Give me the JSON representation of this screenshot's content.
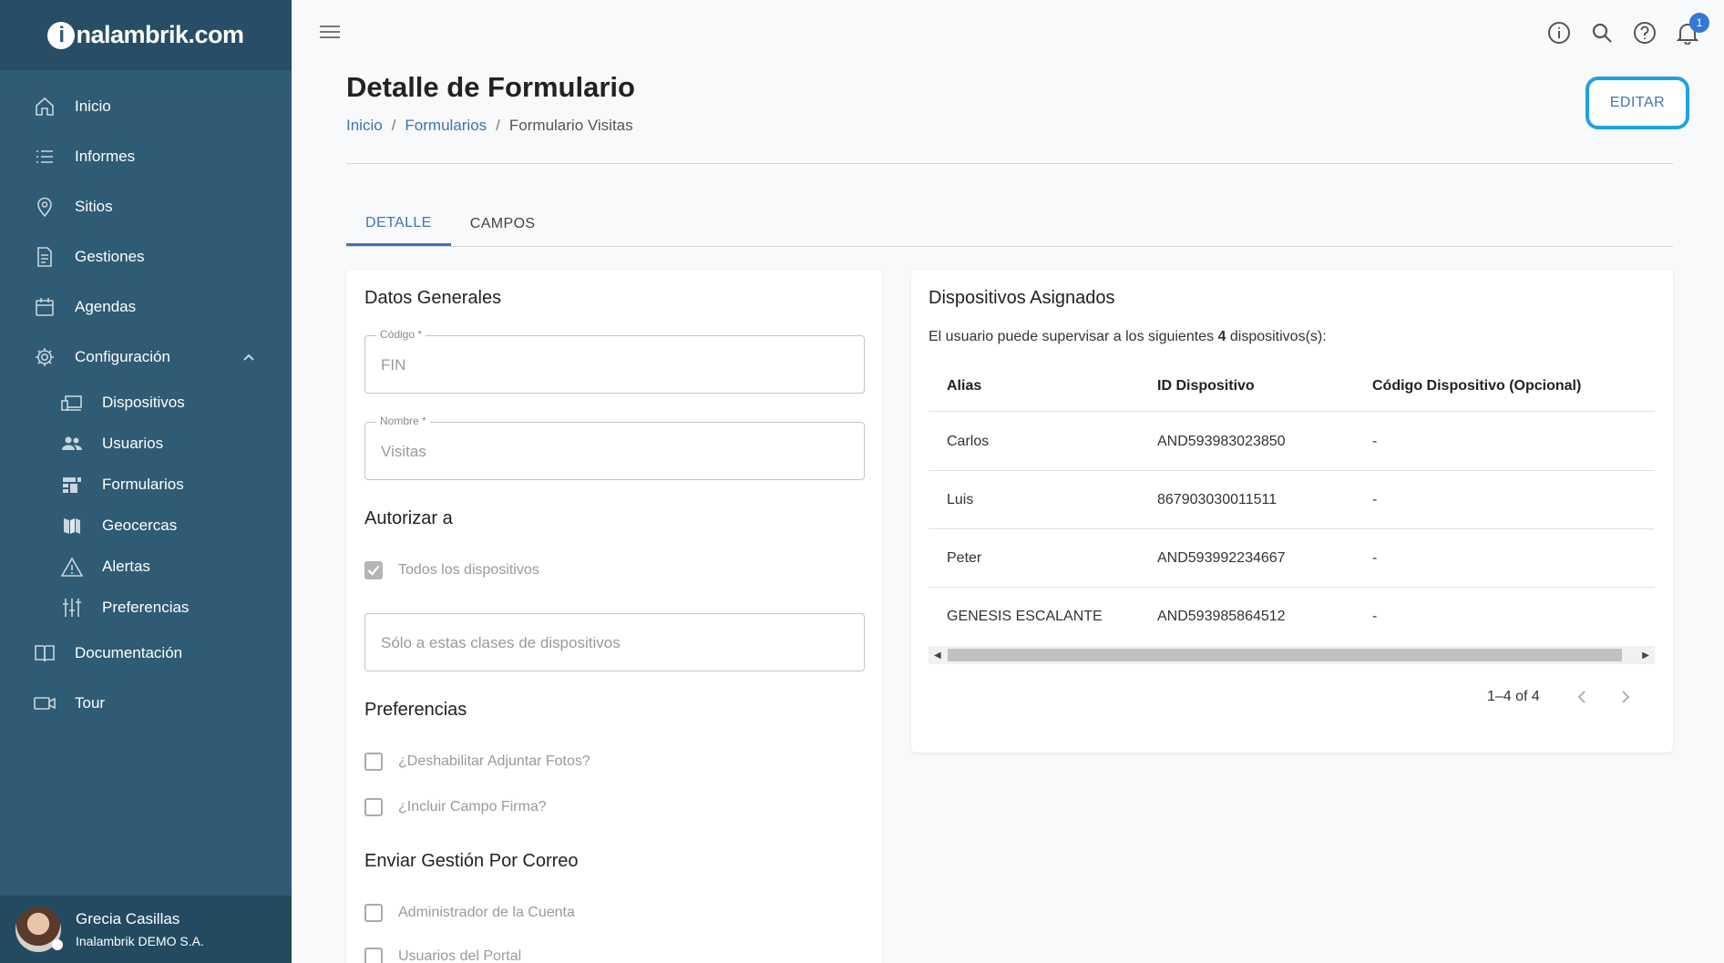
{
  "app": {
    "logo_text": "nalambrik.com",
    "logo_initial": "i"
  },
  "sidebar": {
    "items": [
      {
        "label": "Inicio",
        "icon": "home-icon"
      },
      {
        "label": "Informes",
        "icon": "list-icon"
      },
      {
        "label": "Sitios",
        "icon": "location-pin-icon"
      },
      {
        "label": "Gestiones",
        "icon": "document-icon"
      },
      {
        "label": "Agendas",
        "icon": "calendar-icon"
      },
      {
        "label": "Configuración",
        "icon": "gear-icon"
      }
    ],
    "subitems": [
      {
        "label": "Dispositivos",
        "icon": "devices-icon"
      },
      {
        "label": "Usuarios",
        "icon": "users-icon"
      },
      {
        "label": "Formularios",
        "icon": "forms-icon"
      },
      {
        "label": "Geocercas",
        "icon": "map-icon"
      },
      {
        "label": "Alertas",
        "icon": "warning-icon"
      },
      {
        "label": "Preferencias",
        "icon": "sliders-icon"
      }
    ],
    "bottom_items": [
      {
        "label": "Documentación",
        "icon": "book-icon"
      },
      {
        "label": "Tour",
        "icon": "video-icon"
      }
    ],
    "user": {
      "name": "Grecia Casillas",
      "org": "Inalambrik DEMO S.A."
    }
  },
  "topbar": {
    "notification_count": "1"
  },
  "header": {
    "title": "Detalle de Formulario",
    "breadcrumb": [
      "Inicio",
      "Formularios",
      "Formulario Visitas"
    ],
    "separator": "/",
    "edit_label": "EDITAR"
  },
  "tabs": [
    {
      "label": "DETALLE",
      "active": true
    },
    {
      "label": "CAMPOS",
      "active": false
    }
  ],
  "general": {
    "title": "Datos Generales",
    "code_label": "Código *",
    "code_value": "FIN",
    "name_label": "Nombre *",
    "name_value": "Visitas"
  },
  "authorize": {
    "title": "Autorizar a",
    "all_devices_label": "Todos los dispositivos",
    "all_devices_checked": true,
    "classes_placeholder": "Sólo a estas clases de dispositivos"
  },
  "preferences": {
    "title": "Preferencias",
    "options": [
      "¿Deshabilitar Adjuntar Fotos?",
      "¿Incluir Campo Firma?"
    ]
  },
  "email": {
    "title": "Enviar Gestión Por Correo",
    "options": [
      "Administrador de la Cuenta",
      "Usuarios del Portal"
    ]
  },
  "devices": {
    "title": "Dispositivos Asignados",
    "desc_pre": "El usuario puede supervisar a los siguientes ",
    "desc_count": "4",
    "desc_post": " dispositivos(s):",
    "columns": [
      "Alias",
      "ID Dispositivo",
      "Código Dispositivo (Opcional)"
    ],
    "rows": [
      [
        "Carlos",
        "AND593983023850",
        "-"
      ],
      [
        "Luis",
        "867903030011511",
        "-"
      ],
      [
        "Peter",
        "AND593992234667",
        "-"
      ],
      [
        "GENESIS ESCALANTE",
        "AND593985864512",
        "-"
      ]
    ],
    "pagination": "1–4 of 4"
  }
}
